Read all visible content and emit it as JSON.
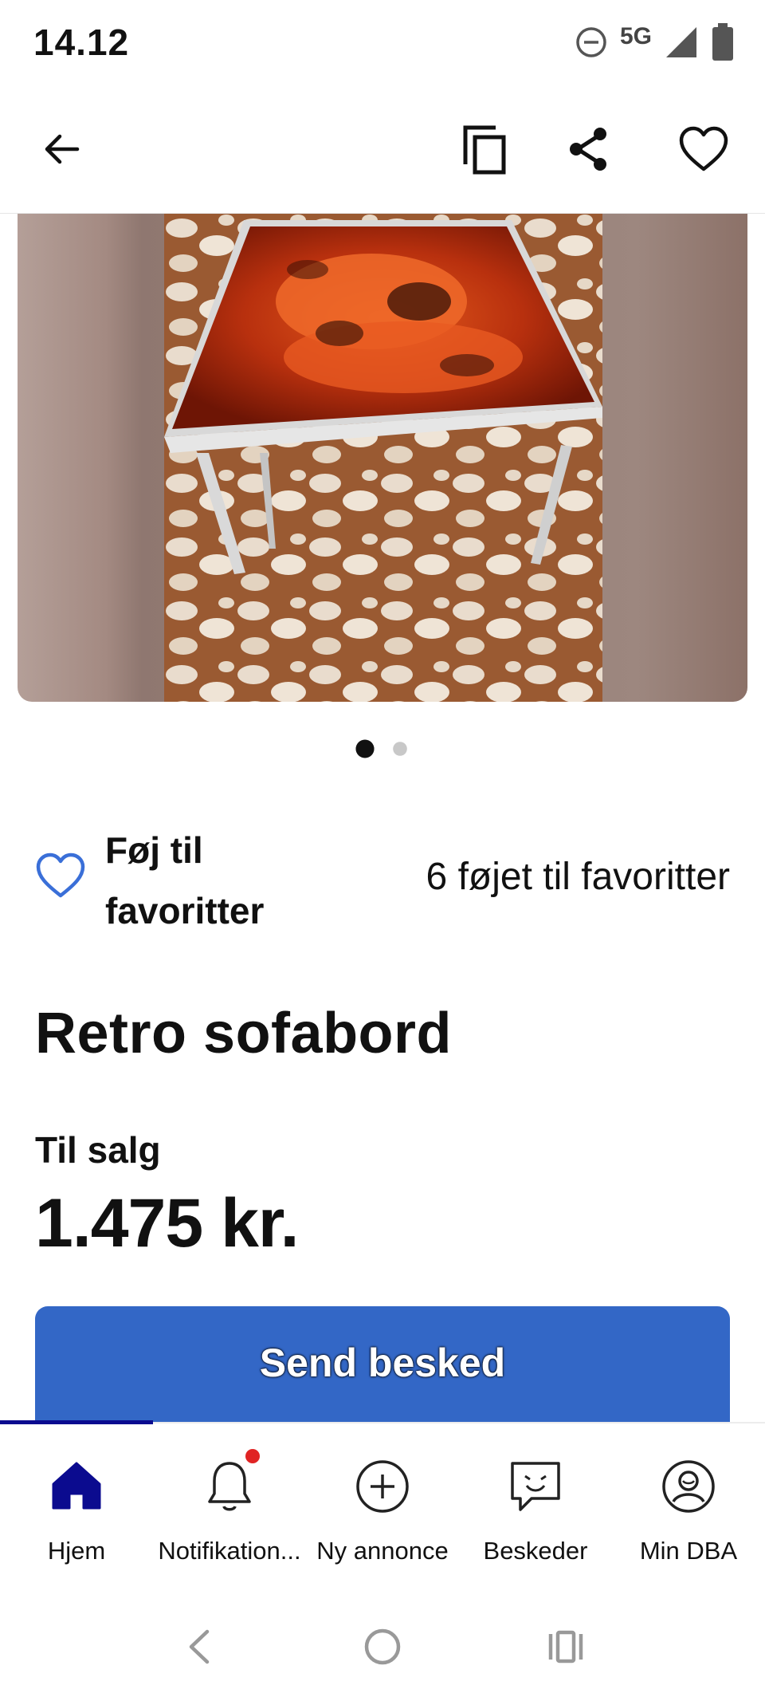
{
  "status_bar": {
    "time": "14.12",
    "network": "5G",
    "icons": [
      "do-not-disturb-icon",
      "signal-icon",
      "battery-icon"
    ]
  },
  "toolbar": {
    "icons": [
      "back-arrow-icon",
      "copy-icon",
      "share-icon",
      "heart-outline-icon"
    ]
  },
  "gallery": {
    "image_count": 2,
    "active_index": 0
  },
  "favorite": {
    "label": "Føj til favoritter",
    "label_line1": "Føj til",
    "label_line2": "favoritter",
    "count_text": "6 føjet til favoritter"
  },
  "listing": {
    "title": "Retro sofabord",
    "sale_type": "Til salg",
    "price": "1.475 kr."
  },
  "actions": {
    "send_message": "Send besked"
  },
  "bottom_nav": {
    "items": [
      {
        "label": "Hjem",
        "icon": "home-icon",
        "active": true
      },
      {
        "label": "Notifikation...",
        "icon": "bell-icon",
        "badge": true
      },
      {
        "label": "Ny annonce",
        "icon": "plus-circle-icon"
      },
      {
        "label": "Beskeder",
        "icon": "chat-icon"
      },
      {
        "label": "Min DBA",
        "icon": "profile-icon"
      }
    ]
  },
  "colors": {
    "primary": "#3367c6",
    "nav_active": "#0b0b8f",
    "heart_blue": "#3a6fd8",
    "badge": "#e02424"
  }
}
